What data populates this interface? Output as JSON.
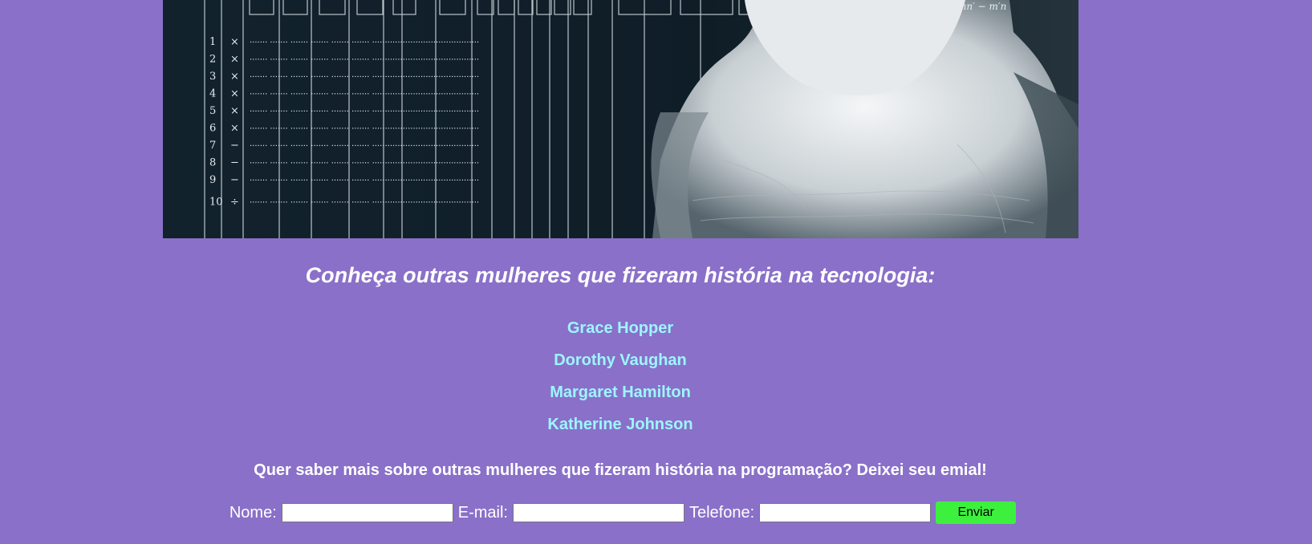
{
  "hero": {
    "image_name": "ada-lovelace-analytical-engine-diagram",
    "diagram_row_numbers": [
      "1",
      "2",
      "3",
      "4",
      "5",
      "6",
      "7",
      "8",
      "9",
      "10"
    ],
    "diagram_operators": [
      "×",
      "×",
      "×",
      "×",
      "×",
      "×",
      "−",
      "−",
      "−",
      "÷"
    ]
  },
  "main": {
    "heading": "Conheça outras mulheres que fizeram história na tecnologia:",
    "women_links": [
      "Grace Hopper",
      "Dorothy Vaughan",
      "Margaret Hamilton",
      "Katherine Johnson"
    ],
    "cta": "Quer saber mais sobre outras mulheres que fizeram história na programação? Deixei seu emial!"
  },
  "form": {
    "name_label": "Nome:",
    "name_value": "",
    "email_label": "E-mail:",
    "email_value": "",
    "phone_label": "Telefone:",
    "phone_value": "",
    "submit_label": "Enviar"
  },
  "colors": {
    "background": "#8a70c9",
    "link": "#9cf6ff",
    "submit": "#3ef03e"
  }
}
